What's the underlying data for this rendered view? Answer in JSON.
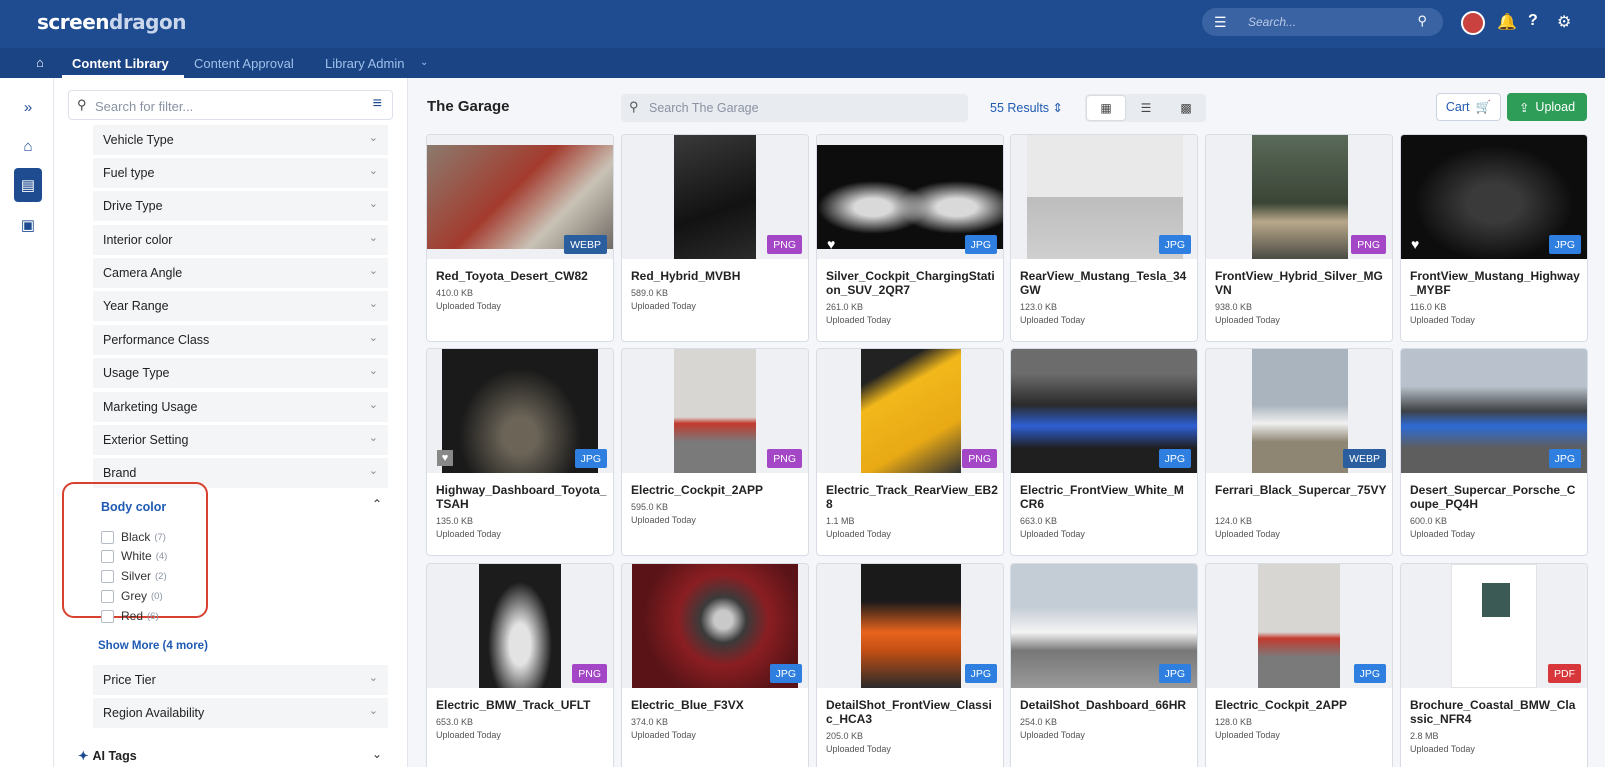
{
  "app": {
    "logo_main": "screen",
    "logo_accent": "dragon",
    "search_placeholder": "Search..."
  },
  "subnav": {
    "tabs": [
      "Content Library",
      "Content Approval",
      "Library Admin"
    ],
    "active_tab": "Content Library"
  },
  "filter": {
    "search_placeholder": "Search for filter...",
    "groups": [
      "Vehicle Type",
      "Fuel type",
      "Drive Type",
      "Interior color",
      "Camera Angle",
      "Year Range",
      "Performance Class",
      "Usage Type",
      "Marketing Usage",
      "Exterior Setting",
      "Brand"
    ],
    "expanded_group": "Body color",
    "options": [
      {
        "name": "Black",
        "count": "(7)"
      },
      {
        "name": "White",
        "count": "(4)"
      },
      {
        "name": "Silver",
        "count": "(2)"
      },
      {
        "name": "Grey",
        "count": "(0)"
      },
      {
        "name": "Red",
        "count": "(6)"
      }
    ],
    "show_more": "Show More (4 more)",
    "groups_after": [
      "Price Tier",
      "Region Availability"
    ],
    "ai_tags": "AI Tags"
  },
  "main": {
    "title": "The Garage",
    "search_placeholder": "Search The Garage",
    "results": "55 Results",
    "cart_label": "Cart",
    "upload_label": "Upload"
  },
  "assets": [
    {
      "title": "Red_Toyota_Desert_CW82",
      "size": "410.0 KB",
      "uploaded": "Uploaded Today",
      "badge": "WEBP",
      "favorite": false
    },
    {
      "title": "Red_Hybrid_MVBH",
      "size": "589.0 KB",
      "uploaded": "Uploaded Today",
      "badge": "PNG",
      "favorite": false
    },
    {
      "title": "Silver_Cockpit_ChargingStation_SUV_2QR7",
      "size": "261.0 KB",
      "uploaded": "Uploaded Today",
      "badge": "JPG",
      "favorite": true
    },
    {
      "title": "RearView_Mustang_Tesla_34GW",
      "size": "123.0 KB",
      "uploaded": "Uploaded Today",
      "badge": "JPG",
      "favorite": false
    },
    {
      "title": "FrontView_Hybrid_Silver_MGVN",
      "size": "938.0 KB",
      "uploaded": "Uploaded Today",
      "badge": "PNG",
      "favorite": false
    },
    {
      "title": "FrontView_Mustang_Highway_MYBF",
      "size": "116.0 KB",
      "uploaded": "Uploaded Today",
      "badge": "JPG",
      "favorite": true
    },
    {
      "title": "Highway_Dashboard_Toyota_TSAH",
      "size": "135.0 KB",
      "uploaded": "Uploaded Today",
      "badge": "JPG",
      "favorite": true
    },
    {
      "title": "Electric_Cockpit_2APP",
      "size": "595.0 KB",
      "uploaded": "Uploaded Today",
      "badge": "PNG",
      "favorite": false
    },
    {
      "title": "Electric_Track_RearView_EB28",
      "size": "1.1 MB",
      "uploaded": "Uploaded Today",
      "badge": "PNG",
      "favorite": false
    },
    {
      "title": "Electric_FrontView_White_MCR6",
      "size": "663.0 KB",
      "uploaded": "Uploaded Today",
      "badge": "JPG",
      "favorite": false
    },
    {
      "title": "Ferrari_Black_Supercar_75VY",
      "size": "124.0 KB",
      "uploaded": "Uploaded Today",
      "badge": "WEBP",
      "favorite": false
    },
    {
      "title": "Desert_Supercar_Porsche_Coupe_PQ4H",
      "size": "600.0 KB",
      "uploaded": "Uploaded Today",
      "badge": "JPG",
      "favorite": false
    },
    {
      "title": "Electric_BMW_Track_UFLT",
      "size": "653.0 KB",
      "uploaded": "Uploaded Today",
      "badge": "PNG",
      "favorite": false
    },
    {
      "title": "Electric_Blue_F3VX",
      "size": "374.0 KB",
      "uploaded": "Uploaded Today",
      "badge": "JPG",
      "favorite": false
    },
    {
      "title": "DetailShot_FrontView_Classic_HCA3",
      "size": "205.0 KB",
      "uploaded": "Uploaded Today",
      "badge": "JPG",
      "favorite": false
    },
    {
      "title": "DetailShot_Dashboard_66HR",
      "size": "254.0 KB",
      "uploaded": "Uploaded Today",
      "badge": "JPG",
      "favorite": false
    },
    {
      "title": "Electric_Cockpit_2APP",
      "size": "128.0 KB",
      "uploaded": "Uploaded Today",
      "badge": "JPG",
      "favorite": false
    },
    {
      "title": "Brochure_Coastal_BMW_Classic_NFR4",
      "size": "2.8 MB",
      "uploaded": "Uploaded Today",
      "badge": "PDF",
      "favorite": false
    }
  ],
  "colors": {
    "brand_dark": "#1f4c91",
    "accent_blue": "#1f5ab3",
    "upload_green": "#2e9d58",
    "badge_jpg": "#2f7fe0",
    "badge_png": "#a347c6",
    "badge_webp": "#2a5e9e",
    "badge_pdf": "#d7363a",
    "highlight_red": "#d9412f"
  }
}
